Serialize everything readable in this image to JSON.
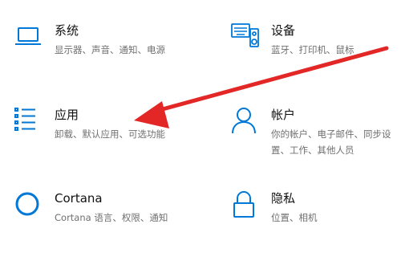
{
  "colors": {
    "accent": "#0078d7",
    "arrow": "#e32727"
  },
  "tiles": [
    {
      "key": "system",
      "icon": "laptop-icon",
      "title": "系统",
      "desc": "显示器、声音、通知、电源"
    },
    {
      "key": "devices",
      "icon": "keyboard-icon",
      "title": "设备",
      "desc": "蓝牙、打印机、鼠标"
    },
    {
      "key": "apps",
      "icon": "apps-list-icon",
      "title": "应用",
      "desc": "卸载、默认应用、可选功能"
    },
    {
      "key": "accounts",
      "icon": "person-icon",
      "title": "帐户",
      "desc": "你的帐户、电子邮件、同步设置、工作、其他人员"
    },
    {
      "key": "cortana",
      "icon": "cortana-icon",
      "title": "Cortana",
      "desc": "Cortana 语言、权限、通知"
    },
    {
      "key": "privacy",
      "icon": "lock-icon",
      "title": "隐私",
      "desc": "位置、相机"
    }
  ]
}
